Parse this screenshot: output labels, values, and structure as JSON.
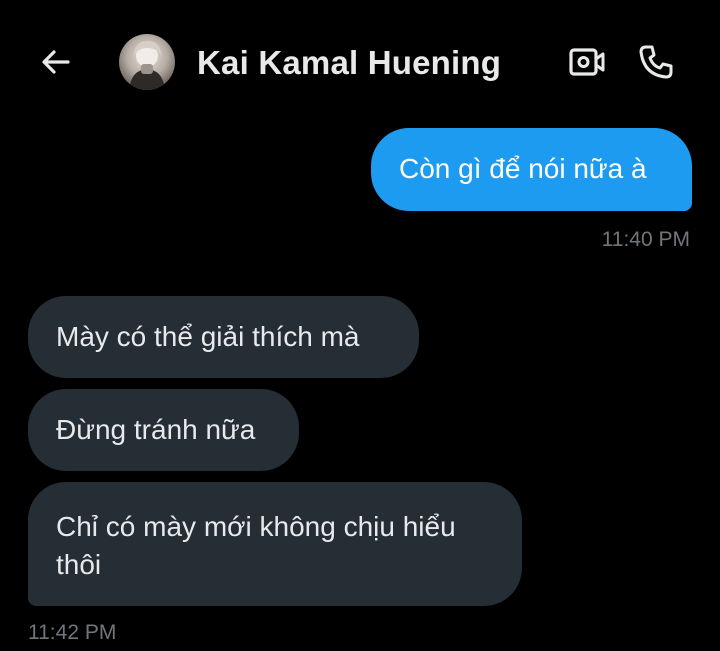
{
  "header": {
    "contact_name": "Kai Kamal Huening",
    "back_icon": "arrow-left-icon",
    "video_icon": "video-camera-icon",
    "call_icon": "phone-icon"
  },
  "messages": {
    "outgoing": [
      {
        "text": "Còn gì để nói nữa à",
        "time": "11:40 PM"
      }
    ],
    "incoming": [
      {
        "text": "Mày có thể giải thích mà"
      },
      {
        "text": "Đừng tránh nữa"
      },
      {
        "text": "Chỉ có mày mới không chịu hiểu thôi",
        "time": "11:42 PM"
      }
    ]
  },
  "colors": {
    "background": "#000000",
    "outgoing_bubble": "#1d9bf0",
    "incoming_bubble": "#252d35",
    "timestamp": "#71767b"
  }
}
